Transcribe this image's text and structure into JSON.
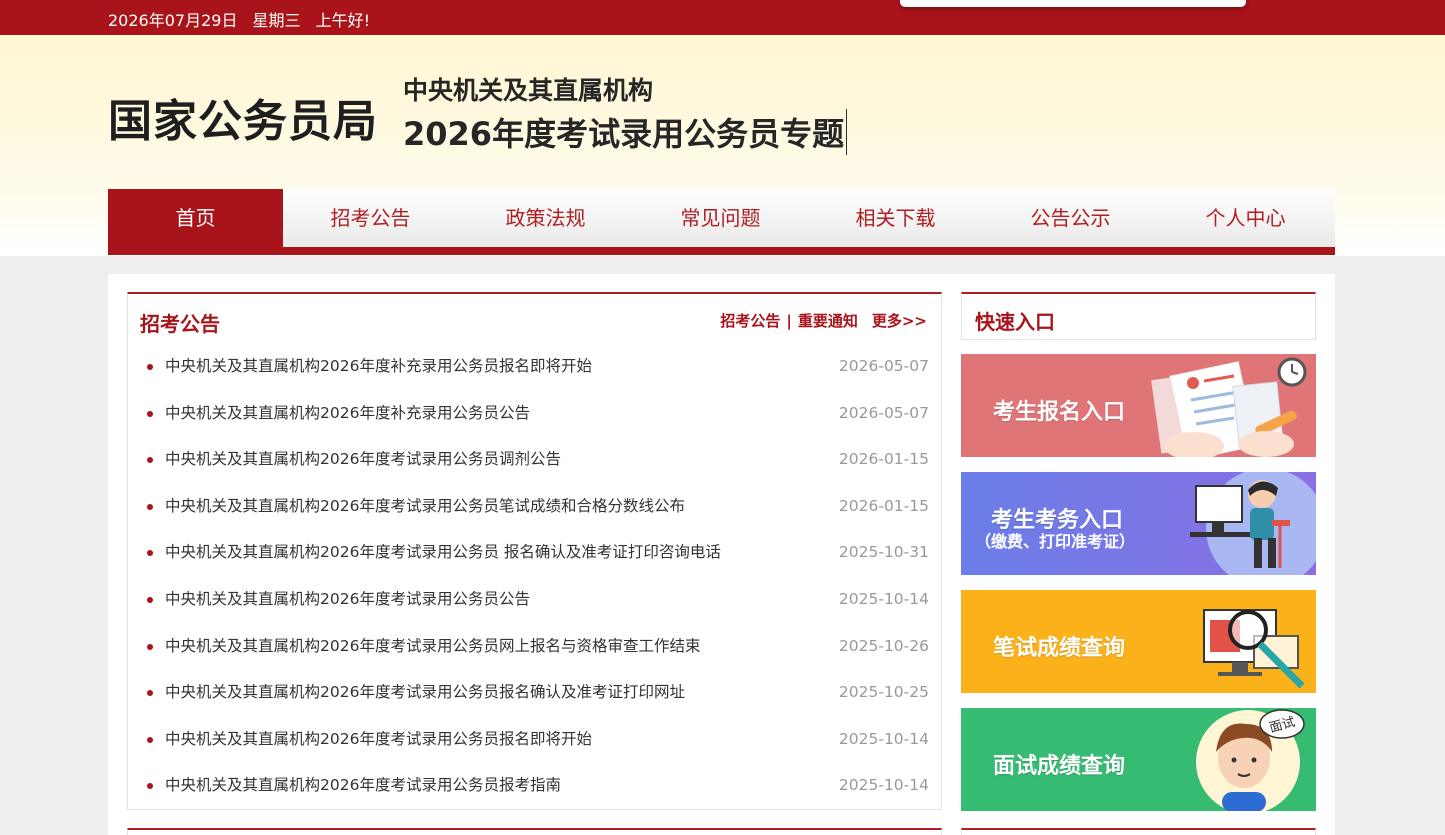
{
  "topbar": {
    "date": "2026年07月29日",
    "weekday": "星期三",
    "greeting": "上午好!"
  },
  "header": {
    "logo": "国家公务员局",
    "subtitle": "中央机关及其直属机构",
    "title": "2026年度考试录用公务员专题"
  },
  "nav": {
    "items": [
      "首页",
      "招考公告",
      "政策法规",
      "常见问题",
      "相关下载",
      "公告公示",
      "个人中心"
    ]
  },
  "notice": {
    "title": "招考公告",
    "link1": "招考公告",
    "separator": "|",
    "link2": "重要通知",
    "more": "更多>>",
    "items": [
      {
        "text": "中央机关及其直属机构2026年度补充录用公务员报名即将开始",
        "date": "2026-05-07"
      },
      {
        "text": "中央机关及其直属机构2026年度补充录用公务员公告",
        "date": "2026-05-07"
      },
      {
        "text": "中央机关及其直属机构2026年度考试录用公务员调剂公告",
        "date": "2026-01-15"
      },
      {
        "text": "中央机关及其直属机构2026年度考试录用公务员笔试成绩和合格分数线公布",
        "date": "2026-01-15"
      },
      {
        "text": "中央机关及其直属机构2026年度考试录用公务员 报名确认及准考证打印咨询电话",
        "date": "2025-10-31"
      },
      {
        "text": "中央机关及其直属机构2026年度考试录用公务员公告",
        "date": "2025-10-14"
      },
      {
        "text": "中央机关及其直属机构2026年度考试录用公务员网上报名与资格审查工作结束",
        "date": "2025-10-26"
      },
      {
        "text": "中央机关及其直属机构2026年度考试录用公务员报名确认及准考证打印网址",
        "date": "2025-10-25"
      },
      {
        "text": "中央机关及其直属机构2026年度考试录用公务员报名即将开始",
        "date": "2025-10-14"
      },
      {
        "text": "中央机关及其直属机构2026年度考试录用公务员报考指南",
        "date": "2025-10-14"
      }
    ]
  },
  "quick": {
    "title": "快速入口",
    "tiles": [
      {
        "label": "考生报名入口",
        "sub": "",
        "color": "#e07578"
      },
      {
        "label": "考生考务入口",
        "sub": "（缴费、打印准考证）",
        "color": "#7b6fe6"
      },
      {
        "label": "笔试成绩查询",
        "sub": "",
        "color": "#fbb11a"
      },
      {
        "label": "面试成绩查询",
        "sub": "",
        "color": "#35bb72",
        "badge": "面试"
      }
    ]
  },
  "colors": {
    "brand_red": "#a8141a",
    "header_bg": "#fff6d2"
  }
}
